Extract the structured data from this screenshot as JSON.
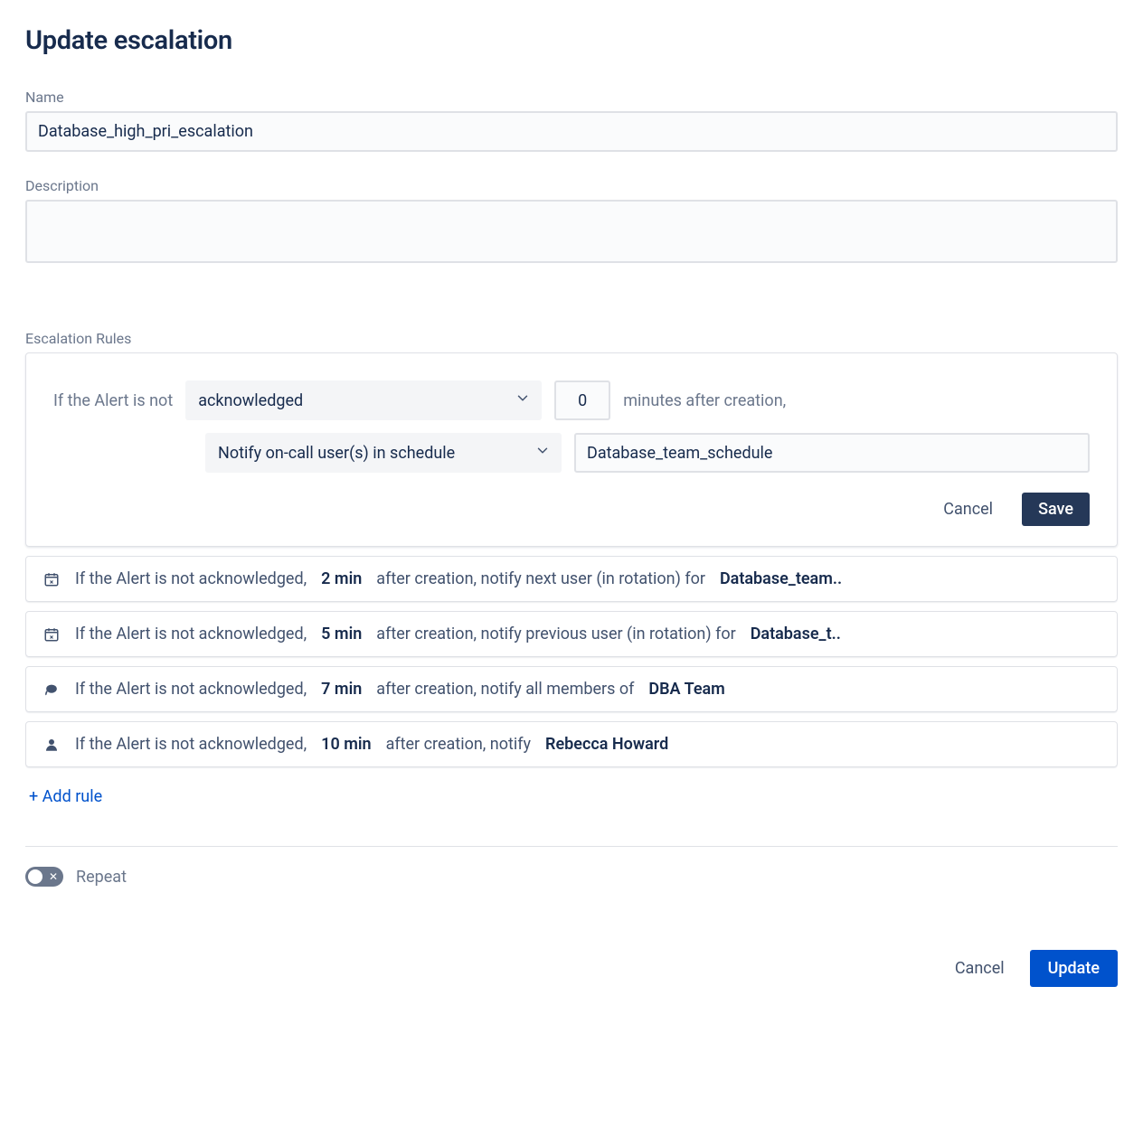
{
  "title": "Update escalation",
  "labels": {
    "name": "Name",
    "description": "Description",
    "rules": "Escalation Rules",
    "repeat": "Repeat"
  },
  "form": {
    "name_value": "Database_high_pri_escalation",
    "description_value": ""
  },
  "editor": {
    "prefix": "If the Alert is not",
    "condition_value": "acknowledged",
    "minutes_value": "0",
    "minutes_suffix": "minutes after creation,",
    "action_value": "Notify on-call user(s) in schedule",
    "target_value": "Database_team_schedule",
    "cancel": "Cancel",
    "save": "Save"
  },
  "rules": [
    {
      "icon": "schedule",
      "prefix": "If the Alert is not acknowledged,",
      "time": "2 min",
      "mid": "after creation, notify next user (in rotation) for",
      "target": "Database_team.."
    },
    {
      "icon": "schedule",
      "prefix": "If the Alert is not acknowledged,",
      "time": "5 min",
      "mid": "after creation, notify previous user (in rotation) for",
      "target": "Database_t.."
    },
    {
      "icon": "team",
      "prefix": "If the Alert is not acknowledged,",
      "time": "7 min",
      "mid": "after creation, notify all members of",
      "target": "DBA Team"
    },
    {
      "icon": "user",
      "prefix": "If the Alert is not acknowledged,",
      "time": "10 min",
      "mid": "after creation, notify",
      "target": "Rebecca Howard"
    }
  ],
  "add_rule": "+ Add rule",
  "repeat_enabled": false,
  "footer": {
    "cancel": "Cancel",
    "update": "Update"
  }
}
